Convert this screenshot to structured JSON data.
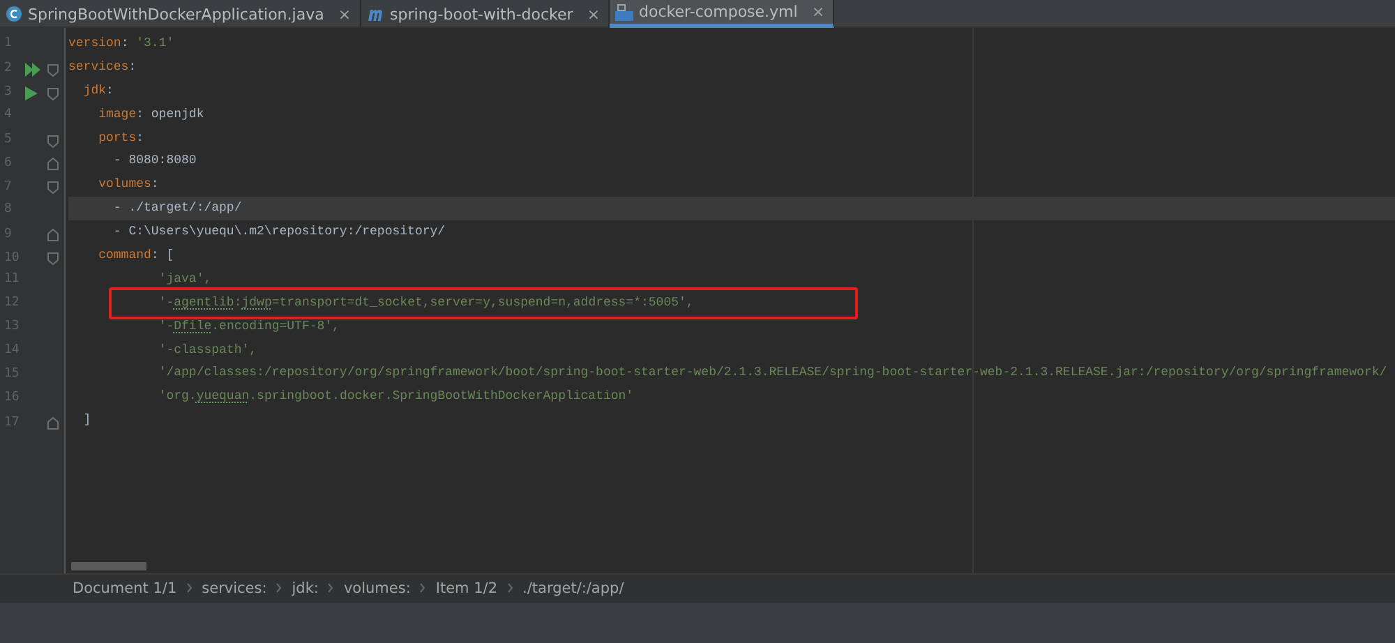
{
  "tabs": [
    {
      "label": "SpringBootWithDockerApplication.java",
      "kind": "java",
      "close": "×",
      "selected": false
    },
    {
      "label": "spring-boot-with-docker",
      "kind": "maven",
      "close": "×",
      "selected": false
    },
    {
      "label": "docker-compose.yml",
      "kind": "docker",
      "close": "×",
      "selected": true
    }
  ],
  "editor": {
    "lines": [
      {
        "number": "1",
        "current": false,
        "annotated": false,
        "tokens": [
          {
            "kind": "key",
            "text": "version"
          },
          {
            "kind": "plain",
            "text": ": "
          },
          {
            "kind": "string",
            "text": "'3.1'"
          }
        ]
      },
      {
        "number": "2",
        "current": false,
        "annotated": false,
        "markers": [
          {
            "kind": "run_all"
          },
          {
            "kind": "fold_start"
          }
        ],
        "tokens": [
          {
            "kind": "key",
            "text": "services"
          },
          {
            "kind": "plain",
            "text": ":"
          }
        ]
      },
      {
        "number": "3",
        "current": false,
        "annotated": false,
        "markers": [
          {
            "kind": "run"
          },
          {
            "kind": "fold_start"
          }
        ],
        "tokens": [
          {
            "kind": "key",
            "text": "  jdk"
          },
          {
            "kind": "plain",
            "text": ":"
          }
        ]
      },
      {
        "number": "4",
        "current": false,
        "annotated": false,
        "tokens": [
          {
            "kind": "key",
            "text": "    image"
          },
          {
            "kind": "plain",
            "text": ": openjdk"
          }
        ]
      },
      {
        "number": "5",
        "current": false,
        "annotated": false,
        "markers": [
          {
            "kind": "fold_start"
          }
        ],
        "tokens": [
          {
            "kind": "key",
            "text": "    ports"
          },
          {
            "kind": "plain",
            "text": ":"
          }
        ]
      },
      {
        "number": "6",
        "current": false,
        "annotated": false,
        "markers": [
          {
            "kind": "fold_end"
          }
        ],
        "tokens": [
          {
            "kind": "plain",
            "text": "      - 8080:8080"
          }
        ]
      },
      {
        "number": "7",
        "current": false,
        "annotated": false,
        "markers": [
          {
            "kind": "fold_start"
          }
        ],
        "tokens": [
          {
            "kind": "key",
            "text": "    volumes"
          },
          {
            "kind": "plain",
            "text": ":"
          }
        ]
      },
      {
        "number": "8",
        "current": true,
        "annotated": false,
        "tokens": [
          {
            "kind": "plain",
            "text": "      - ./target/:/app/"
          }
        ]
      },
      {
        "number": "9",
        "current": false,
        "annotated": false,
        "markers": [
          {
            "kind": "fold_end"
          }
        ],
        "tokens": [
          {
            "kind": "plain",
            "text": "      - C:\\Users\\yuequ\\.m2\\repository:/repository/"
          }
        ]
      },
      {
        "number": "10",
        "current": false,
        "annotated": false,
        "markers": [
          {
            "kind": "fold_start"
          }
        ],
        "tokens": [
          {
            "kind": "key",
            "text": "    command"
          },
          {
            "kind": "plain",
            "text": ": ["
          }
        ]
      },
      {
        "number": "11",
        "current": false,
        "annotated": false,
        "tokens": [
          {
            "kind": "string",
            "text": "            'java',"
          }
        ]
      },
      {
        "number": "12",
        "current": false,
        "annotated": true,
        "tokens": [
          {
            "kind": "string",
            "text": "            '-"
          },
          {
            "kind": "typo",
            "text": "agentlib"
          },
          {
            "kind": "string",
            "text": ":"
          },
          {
            "kind": "typo",
            "text": "jdwp"
          },
          {
            "kind": "string",
            "text": "=transport=dt_socket,server=y,suspend=n,address=*:5005',"
          }
        ]
      },
      {
        "number": "13",
        "current": false,
        "annotated": false,
        "tokens": [
          {
            "kind": "string",
            "text": "            '-"
          },
          {
            "kind": "typo",
            "text": "Dfile"
          },
          {
            "kind": "string",
            "text": ".encoding=UTF-8',"
          }
        ]
      },
      {
        "number": "14",
        "current": false,
        "annotated": false,
        "tokens": [
          {
            "kind": "string",
            "text": "            '-classpath',"
          }
        ]
      },
      {
        "number": "15",
        "current": false,
        "annotated": false,
        "tokens": [
          {
            "kind": "string",
            "text": "            '/app/classes:/repository/org/springframework/boot/spring-boot-starter-web/2.1.3.RELEASE/spring-boot-starter-web-2.1.3.RELEASE.jar:/repository/org/springframework/"
          }
        ]
      },
      {
        "number": "16",
        "current": false,
        "annotated": false,
        "tokens": [
          {
            "kind": "string",
            "text": "            'org."
          },
          {
            "kind": "typo",
            "text": "yuequan"
          },
          {
            "kind": "string",
            "text": ".springboot.docker.SpringBootWithDockerApplication'"
          }
        ]
      },
      {
        "number": "17",
        "current": false,
        "annotated": false,
        "markers": [
          {
            "kind": "fold_end"
          }
        ],
        "tokens": [
          {
            "kind": "plain",
            "text": "  ]"
          }
        ]
      }
    ]
  },
  "breadcrumbs": [
    "Document 1/1",
    "services:",
    "jdk:",
    "volumes:",
    "Item 1/2",
    "./target/:/app/"
  ]
}
